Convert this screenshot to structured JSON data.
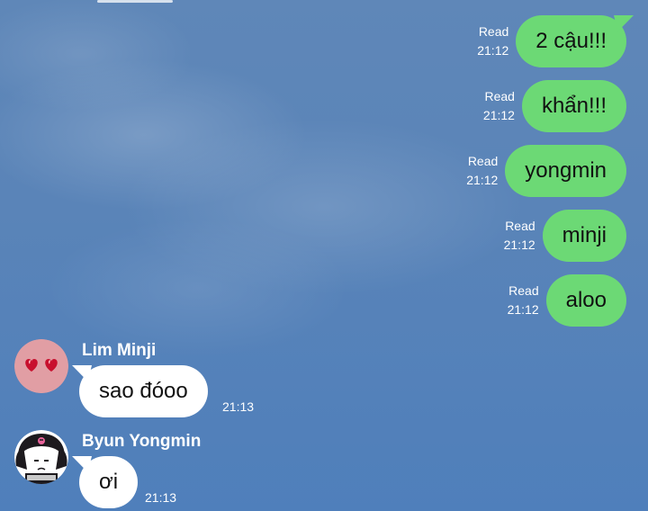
{
  "colors": {
    "background": "#5a84b8",
    "outgoing_bubble": "#6cd975",
    "incoming_bubble": "#ffffff",
    "meta_text": "#ffffff"
  },
  "outgoing": [
    {
      "text": "2 cậu!!!",
      "status": "Read",
      "time": "21:12"
    },
    {
      "text": "khẩn!!!",
      "status": "Read",
      "time": "21:12"
    },
    {
      "text": "yongmin",
      "status": "Read",
      "time": "21:12"
    },
    {
      "text": "minji",
      "status": "Read",
      "time": "21:12"
    },
    {
      "text": "aloo",
      "status": "Read",
      "time": "21:12"
    }
  ],
  "incoming": [
    {
      "sender": "Lim Minji",
      "text": "sao đóoo",
      "time": "21:13",
      "avatar_icon": "heart-eyes-avatar"
    },
    {
      "sender": "Byun Yongmin",
      "text": "ơi",
      "time": "21:13",
      "avatar_icon": "kuromi-avatar"
    }
  ]
}
